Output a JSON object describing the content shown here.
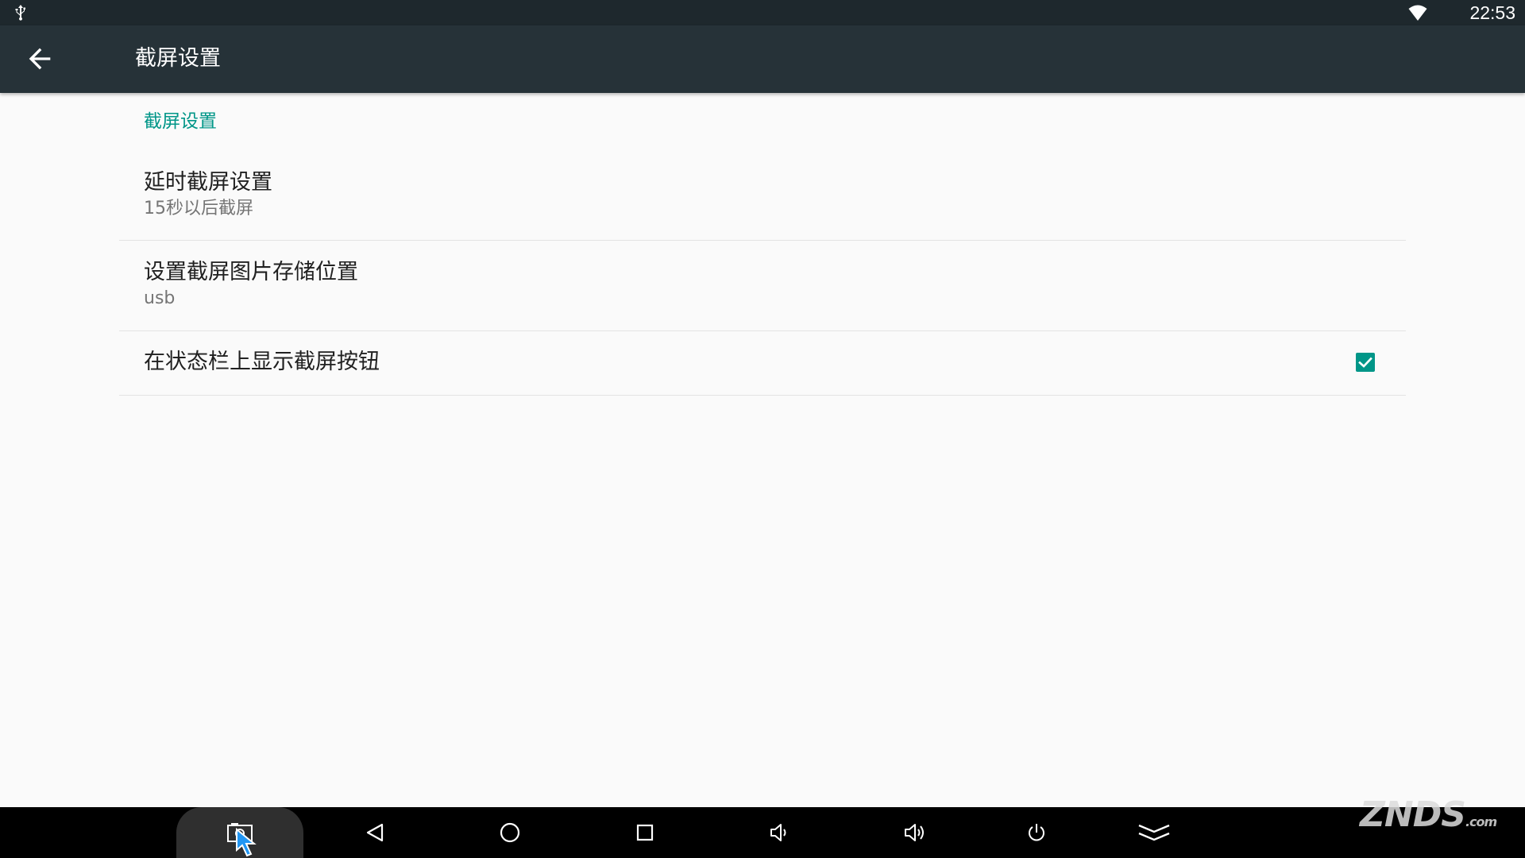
{
  "status_bar": {
    "time": "22:53",
    "usb_icon": "usb-icon",
    "wifi_icon": "wifi-icon"
  },
  "toolbar": {
    "title": "截屏设置",
    "back_icon": "arrow-back-icon"
  },
  "settings": {
    "category": "截屏设置",
    "items": [
      {
        "title": "延时截屏设置",
        "summary": "15秒以后截屏"
      },
      {
        "title": "设置截屏图片存储位置",
        "summary": "usb"
      },
      {
        "title": "在状态栏上显示截屏按钮",
        "checked": true
      }
    ]
  },
  "nav_bar": {
    "buttons": [
      "screenshot-icon",
      "back-triangle-icon",
      "home-circle-icon",
      "recents-square-icon",
      "volume-down-icon",
      "volume-up-icon",
      "power-icon",
      "hide-bar-icon"
    ]
  },
  "watermark": {
    "text": "ZNDS",
    "suffix": ".com"
  },
  "colors": {
    "accent": "#009688",
    "toolbar": "#263238",
    "statusbar": "#1e282d",
    "background": "#fafafa"
  }
}
